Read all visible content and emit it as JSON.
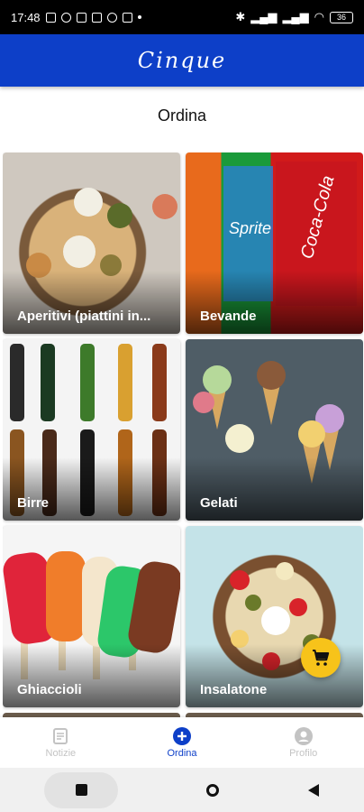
{
  "status_bar": {
    "time": "17:48",
    "battery": "36"
  },
  "header": {
    "logo_text": "Cinque"
  },
  "page": {
    "title": "Ordina"
  },
  "categories": [
    {
      "label": "Aperitivi (piattini in..."
    },
    {
      "label": "Bevande"
    },
    {
      "label": "Birre"
    },
    {
      "label": "Gelati"
    },
    {
      "label": "Ghiaccioli"
    },
    {
      "label": "Insalatone"
    }
  ],
  "fab": {
    "icon": "cart-icon"
  },
  "bottom_nav": {
    "items": [
      {
        "label": "Notizie",
        "icon": "news-icon"
      },
      {
        "label": "Ordina",
        "icon": "add-circle-icon",
        "active": true
      },
      {
        "label": "Profilo",
        "icon": "account-icon"
      }
    ]
  },
  "colors": {
    "brand": "#0d3fc8",
    "fab": "#f7c31a",
    "inactive": "#c3c3c3"
  }
}
